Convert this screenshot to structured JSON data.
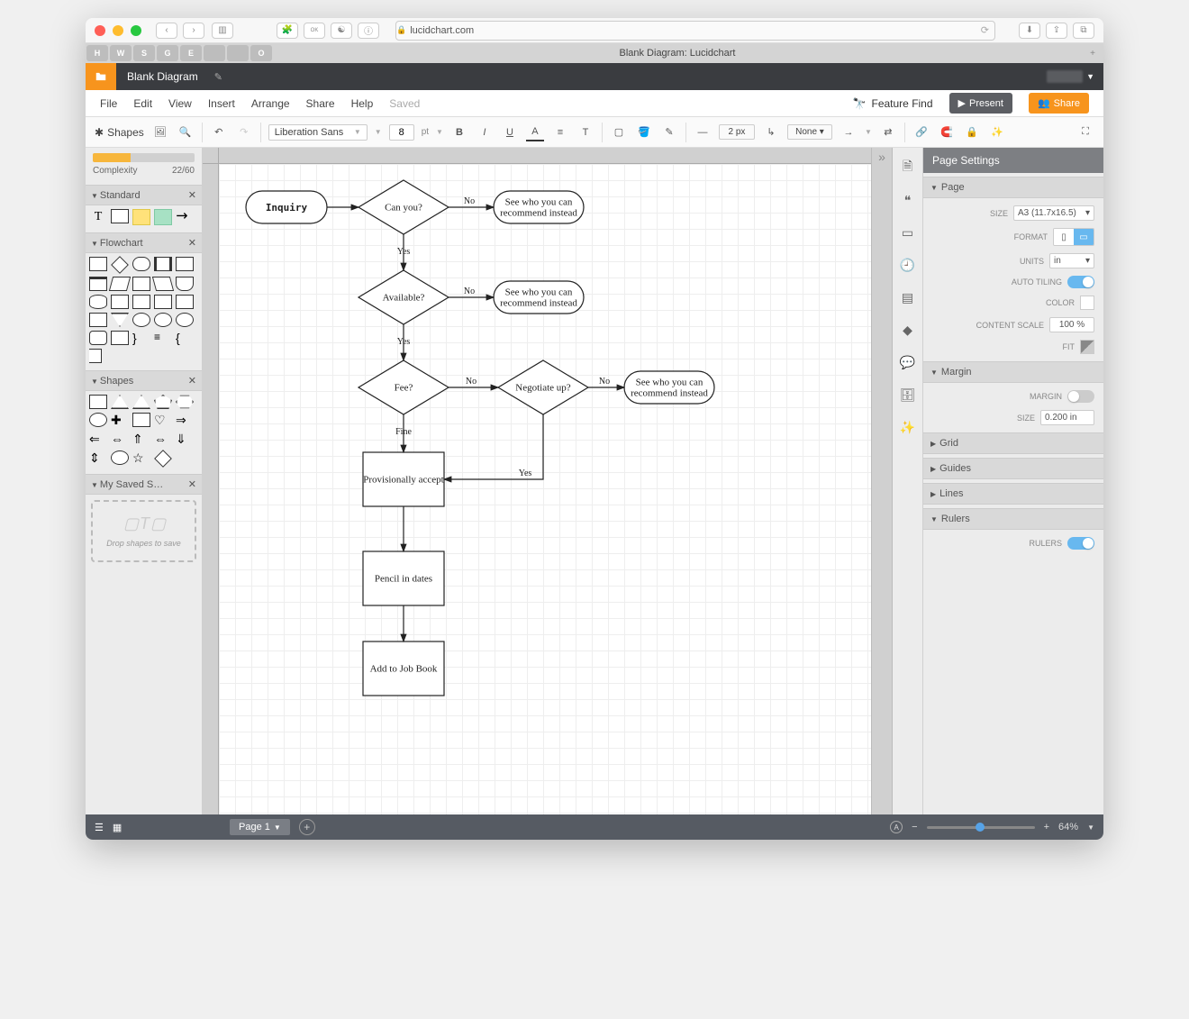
{
  "browser": {
    "url": "lucidchart.com",
    "tab_title": "Blank Diagram: Lucidchart",
    "fav_tabs": [
      "H",
      "W",
      "S",
      "G",
      "E"
    ],
    "apple_tabs": [
      "",
      "",
      "O"
    ]
  },
  "header": {
    "document_title": "Blank Diagram"
  },
  "menubar": {
    "items": [
      "File",
      "Edit",
      "View",
      "Insert",
      "Arrange",
      "Share",
      "Help"
    ],
    "status": "Saved",
    "feature_find": "Feature Find",
    "present": "Present",
    "share": "Share"
  },
  "toolbar": {
    "shapes_label": "Shapes",
    "font": "Liberation Sans",
    "font_size": "8",
    "font_unit": "pt",
    "line_width": "2 px",
    "line_style": "None"
  },
  "left": {
    "complexity_label": "Complexity",
    "complexity_value": "22/60",
    "complexity_pct": 37,
    "sections": {
      "standard": "Standard",
      "flowchart": "Flowchart",
      "shapes": "Shapes",
      "saved": "My Saved S…"
    },
    "saved_drop": "Drop shapes to save"
  },
  "icon_strip": [
    "📄",
    "❝",
    "🖵",
    "🕘",
    "▦",
    "◆",
    "💬",
    "🗄",
    "✨"
  ],
  "right": {
    "title": "Page Settings",
    "sections": {
      "page": "Page",
      "margin": "Margin",
      "grid": "Grid",
      "guides": "Guides",
      "lines": "Lines",
      "rulers": "Rulers"
    },
    "page": {
      "size_label": "SIZE",
      "size_value": "A3 (11.7x16.5)",
      "format_label": "FORMAT",
      "units_label": "UNITS",
      "units_value": "in",
      "autotiling_label": "AUTO TILING",
      "color_label": "COLOR",
      "content_scale_label": "CONTENT SCALE",
      "content_scale_value": "100 %",
      "fit_label": "FIT"
    },
    "margin": {
      "margin_label": "MARGIN",
      "size_label": "SIZE",
      "size_value": "0.200 in"
    },
    "rulers": {
      "rulers_label": "RULERS"
    }
  },
  "footer": {
    "page_tab": "Page 1",
    "zoom": "64%"
  },
  "flowchart": {
    "nodes": {
      "inquiry": "Inquiry",
      "canyou": "Can you?",
      "see1a": "See who you can",
      "see1b": "recommend instead",
      "available": "Available?",
      "see2a": "See who you can",
      "see2b": "recommend instead",
      "fee": "Fee?",
      "negotiate": "Negotiate up?",
      "see3a": "See who you can",
      "see3b": "recommend instead",
      "accept": "Provisionally accept",
      "pencil": "Pencil in dates",
      "jobbook": "Add to Job Book"
    },
    "edges": {
      "no": "No",
      "yes": "Yes",
      "fine": "Fine"
    }
  }
}
